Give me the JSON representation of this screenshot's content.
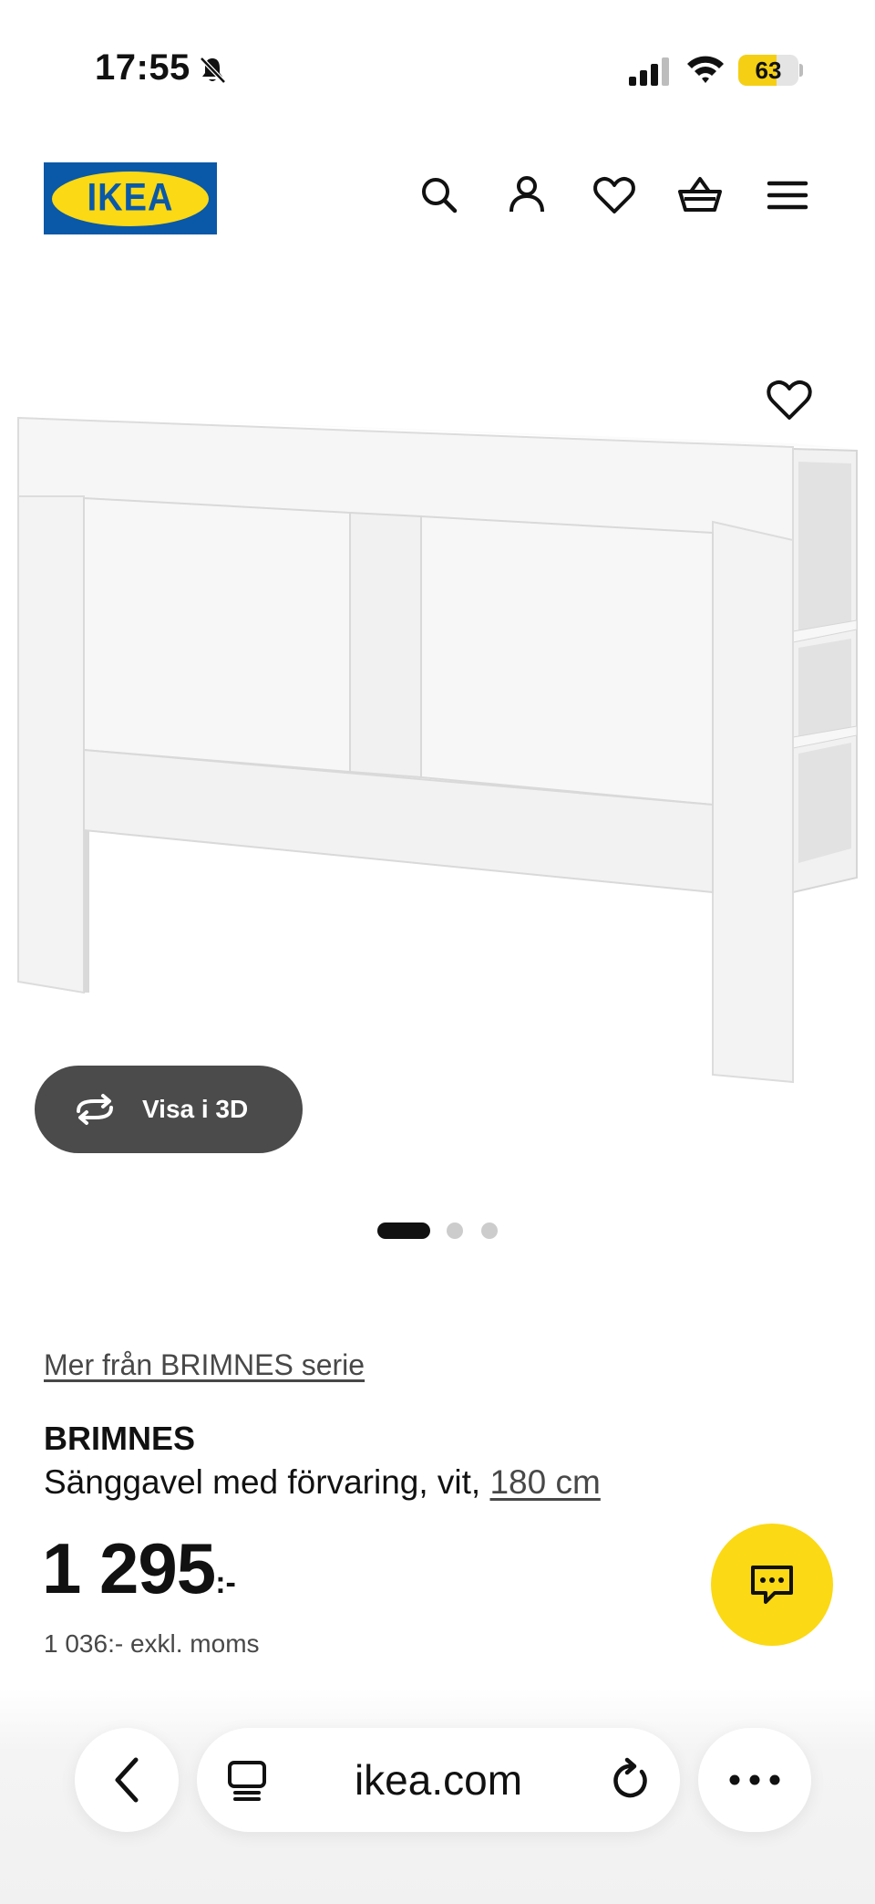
{
  "status_bar": {
    "time": "17:55",
    "battery_level": "63",
    "battery_fraction": 0.63,
    "icons": [
      "bell-slash-icon",
      "signal-icon",
      "wifi-icon",
      "battery-icon"
    ]
  },
  "header": {
    "logo_text": "IKEA",
    "icons": [
      "search-icon",
      "account-icon",
      "wishlist-icon",
      "cart-icon",
      "menu-icon"
    ]
  },
  "gallery": {
    "view_3d_label": "Visa i 3D",
    "dot_count": 3,
    "active_dot": 1
  },
  "product": {
    "series_link": "Mer från BRIMNES serie",
    "name": "BRIMNES",
    "description": "Sänggavel med förvaring, vit,",
    "size": "180 cm",
    "price": "1 295",
    "price_suffix": ":-",
    "price_excl_vat": "1 036:- exkl. moms"
  },
  "browser_toolbar": {
    "url": "ikea.com"
  },
  "colors": {
    "ikea_blue": "#0a58a8",
    "ikea_yellow": "#fbd914",
    "view3d_bg": "#4b4b4b",
    "text": "#111111",
    "muted": "#484848"
  }
}
